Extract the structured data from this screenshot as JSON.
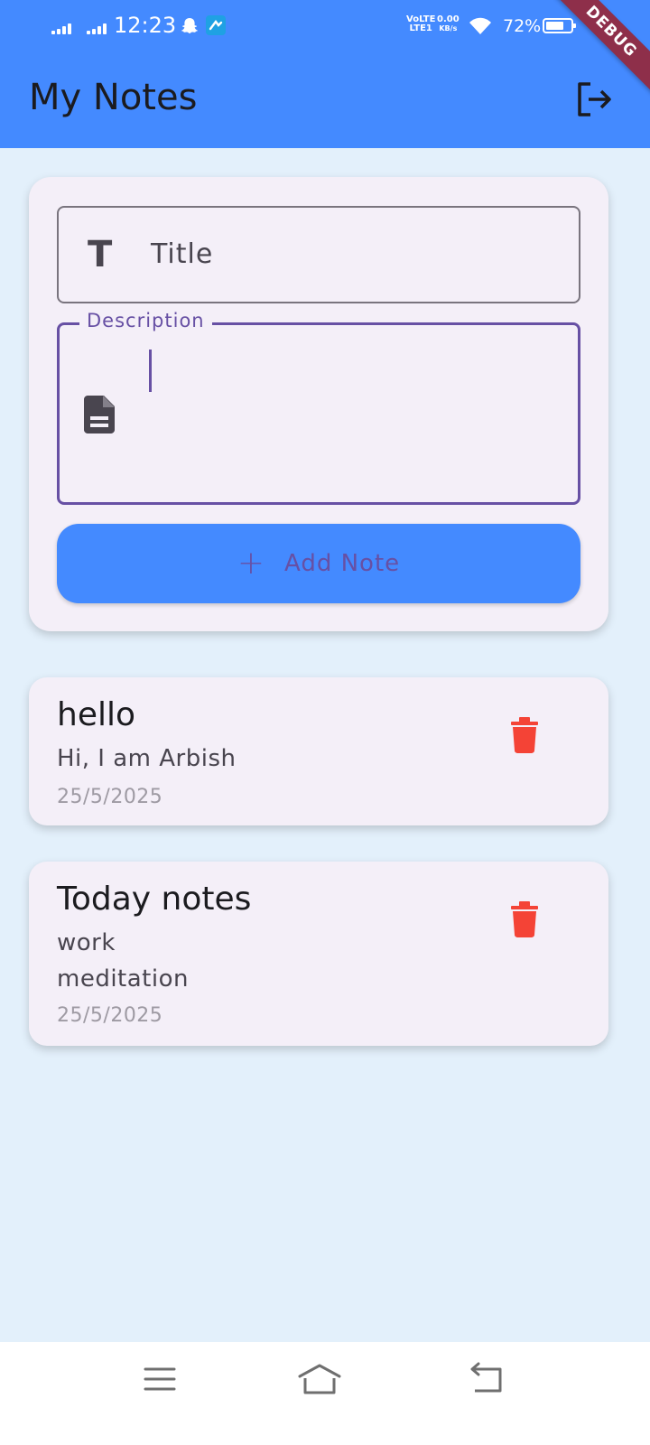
{
  "status_bar": {
    "time": "12:23",
    "network_label": "Vo))\nLTE1",
    "speed_value": "0.00",
    "speed_unit": "KB/s",
    "battery": "72%",
    "battery_level": 0.72
  },
  "debug_banner": "DEBUG",
  "app_bar": {
    "title": "My Notes",
    "action_icon": "logout-icon"
  },
  "form": {
    "title_placeholder": "Title",
    "title_icon": "T",
    "description_label": "Description",
    "description_value": "",
    "add_button_label": "Add Note"
  },
  "notes": [
    {
      "title": "hello",
      "description": "Hi, I am Arbish",
      "date": "25/5/2025"
    },
    {
      "title": "Today notes",
      "description": "work\nmeditation",
      "date": "25/5/2025"
    }
  ],
  "colors": {
    "primary": "#448AFF",
    "background": "#E3F0FB",
    "card": "#F4EFF8",
    "accent": "#6750A4",
    "delete": "#F44336"
  }
}
